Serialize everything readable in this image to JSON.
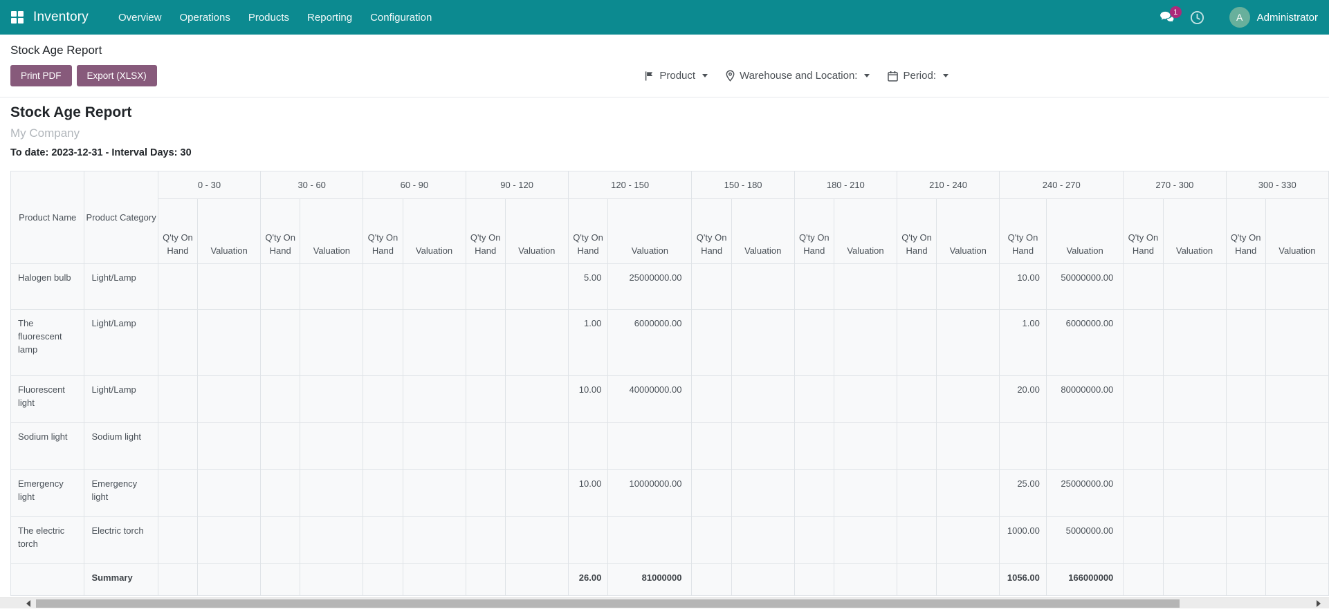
{
  "navbar": {
    "brand": "Inventory",
    "menu_items": [
      {
        "label": "Overview"
      },
      {
        "label": "Operations"
      },
      {
        "label": "Products"
      },
      {
        "label": "Reporting"
      },
      {
        "label": "Configuration"
      }
    ],
    "systray": {
      "message_badge": "1",
      "user_initial": "A",
      "user_name": "Administrator"
    }
  },
  "control_panel": {
    "page_title": "Stock Age Report",
    "print_pdf_label": "Print PDF",
    "export_xlsx_label": "Export (XLSX)",
    "filters": [
      {
        "icon": "flag-icon",
        "label": "Product"
      },
      {
        "icon": "location-pin-icon",
        "label": "Warehouse and Location:"
      },
      {
        "icon": "calendar-icon",
        "label": "Period:"
      }
    ]
  },
  "report": {
    "title": "Stock Age Report",
    "company": "My Company",
    "date_line": "To date: 2023-12-31 - Interval Days: 30"
  },
  "table": {
    "col_product_name": "Product Name",
    "col_product_category": "Product Category",
    "col_qty": "Q'ty On Hand",
    "col_valuation": "Valuation",
    "age_buckets": [
      "0 - 30",
      "30 - 60",
      "60 - 90",
      "90 - 120",
      "120 - 150",
      "150 - 180",
      "180 - 210",
      "210 - 240",
      "240 - 270",
      "270 - 300",
      "300 - 330"
    ],
    "rows": [
      {
        "name": "Halogen bulb",
        "category": "Light/Lamp",
        "bold": false,
        "cells": [
          "",
          "",
          "",
          "",
          "",
          "",
          "",
          "",
          "5.00",
          "25000000.00",
          "",
          "",
          "",
          "",
          "",
          "",
          "10.00",
          "50000000.00",
          "",
          "",
          "",
          ""
        ]
      },
      {
        "name": "The fluorescent lamp",
        "category": "Light/Lamp",
        "bold": false,
        "cells": [
          "",
          "",
          "",
          "",
          "",
          "",
          "",
          "",
          "1.00",
          "6000000.00",
          "",
          "",
          "",
          "",
          "",
          "",
          "1.00",
          "6000000.00",
          "",
          "",
          "",
          ""
        ]
      },
      {
        "name": "Fluorescent light",
        "category": "Light/Lamp",
        "bold": false,
        "cells": [
          "",
          "",
          "",
          "",
          "",
          "",
          "",
          "",
          "10.00",
          "40000000.00",
          "",
          "",
          "",
          "",
          "",
          "",
          "20.00",
          "80000000.00",
          "",
          "",
          "",
          ""
        ]
      },
      {
        "name": "Sodium light",
        "category": "Sodium light",
        "bold": false,
        "cells": [
          "",
          "",
          "",
          "",
          "",
          "",
          "",
          "",
          "",
          "",
          "",
          "",
          "",
          "",
          "",
          "",
          "",
          "",
          "",
          "",
          "",
          ""
        ]
      },
      {
        "name": "Emergency light",
        "category": "Emergency light",
        "bold": false,
        "cells": [
          "",
          "",
          "",
          "",
          "",
          "",
          "",
          "",
          "10.00",
          "10000000.00",
          "",
          "",
          "",
          "",
          "",
          "",
          "25.00",
          "25000000.00",
          "",
          "",
          "",
          ""
        ]
      },
      {
        "name": "The electric torch",
        "category": "Electric torch",
        "bold": false,
        "cells": [
          "",
          "",
          "",
          "",
          "",
          "",
          "",
          "",
          "",
          "",
          "",
          "",
          "",
          "",
          "",
          "",
          "1000.00",
          "5000000.00",
          "",
          "",
          "",
          ""
        ]
      },
      {
        "name": "",
        "category": "Summary",
        "bold": true,
        "cells": [
          "",
          "",
          "",
          "",
          "",
          "",
          "",
          "",
          "26.00",
          "81000000",
          "",
          "",
          "",
          "",
          "",
          "",
          "1056.00",
          "166000000",
          "",
          "",
          "",
          ""
        ]
      }
    ]
  },
  "colors": {
    "navbar_teal": "#0c8a90",
    "button_purple": "#875a7b",
    "badge_magenta": "#ad2a7a",
    "avatar_green": "#68b09c"
  }
}
